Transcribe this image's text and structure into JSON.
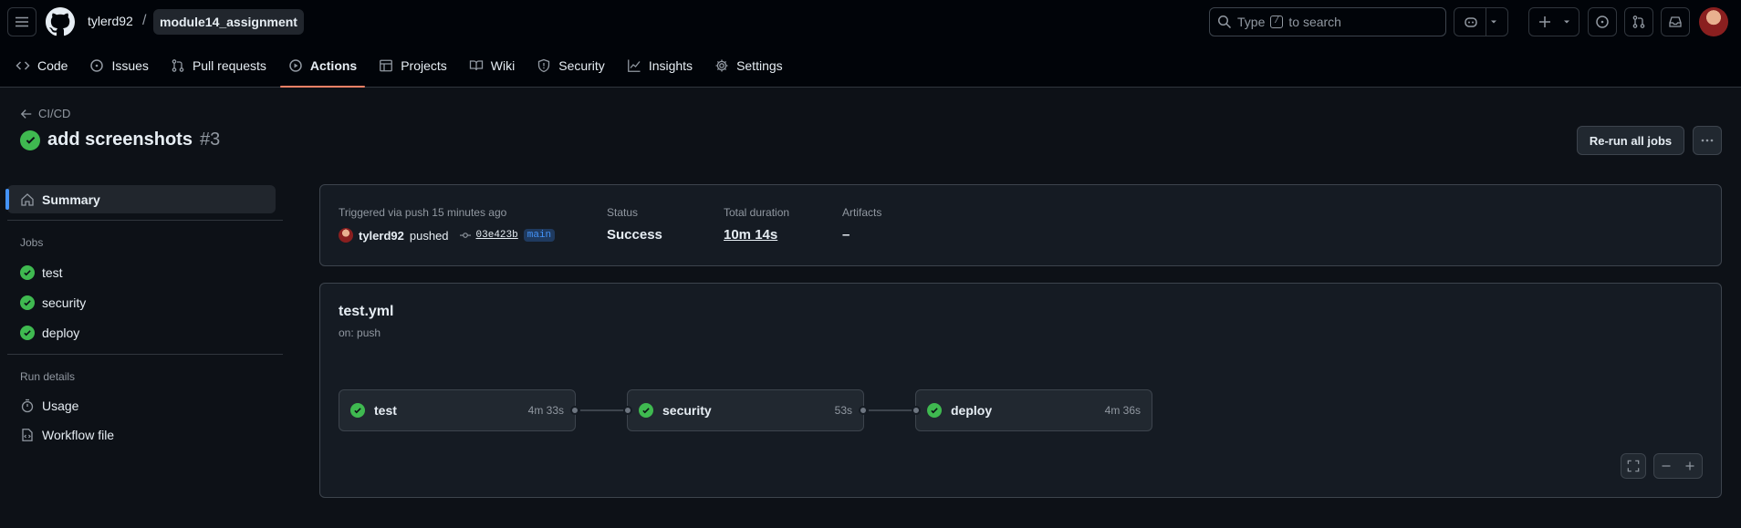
{
  "header": {
    "owner": "tylerd92",
    "separator": "/",
    "repo": "module14_assignment",
    "search": {
      "prefix": "Type",
      "key": "/",
      "suffix": "to search"
    }
  },
  "nav": {
    "items": [
      {
        "label": "Code",
        "icon": "code-icon"
      },
      {
        "label": "Issues",
        "icon": "issue-icon"
      },
      {
        "label": "Pull requests",
        "icon": "pull-request-icon"
      },
      {
        "label": "Actions",
        "icon": "play-icon",
        "active": true
      },
      {
        "label": "Projects",
        "icon": "table-icon"
      },
      {
        "label": "Wiki",
        "icon": "book-icon"
      },
      {
        "label": "Security",
        "icon": "shield-icon"
      },
      {
        "label": "Insights",
        "icon": "graph-icon"
      },
      {
        "label": "Settings",
        "icon": "gear-icon"
      }
    ]
  },
  "run": {
    "back_label": "CI/CD",
    "title": "add screenshots",
    "number": "#3",
    "rerun_label": "Re-run all jobs"
  },
  "sidebar": {
    "summary_label": "Summary",
    "jobs_heading": "Jobs",
    "jobs": [
      "test",
      "security",
      "deploy"
    ],
    "run_details_heading": "Run details",
    "usage_label": "Usage",
    "workflow_file_label": "Workflow file"
  },
  "summary": {
    "trigger": "Triggered via push 15 minutes ago",
    "actor": "tylerd92",
    "action": "pushed",
    "sha": "03e423b",
    "branch": "main",
    "status_label": "Status",
    "status_value": "Success",
    "duration_label": "Total duration",
    "duration_value": "10m 14s",
    "artifacts_label": "Artifacts",
    "artifacts_value": "–"
  },
  "workflow": {
    "file": "test.yml",
    "event": "on: push",
    "jobs": [
      {
        "name": "test",
        "duration": "4m 33s"
      },
      {
        "name": "security",
        "duration": "53s"
      },
      {
        "name": "deploy",
        "duration": "4m 36s"
      }
    ]
  },
  "colors": {
    "success": "#3fb950",
    "accent": "#4493f8",
    "active_tab": "#f78166",
    "background": "#0d1117"
  }
}
